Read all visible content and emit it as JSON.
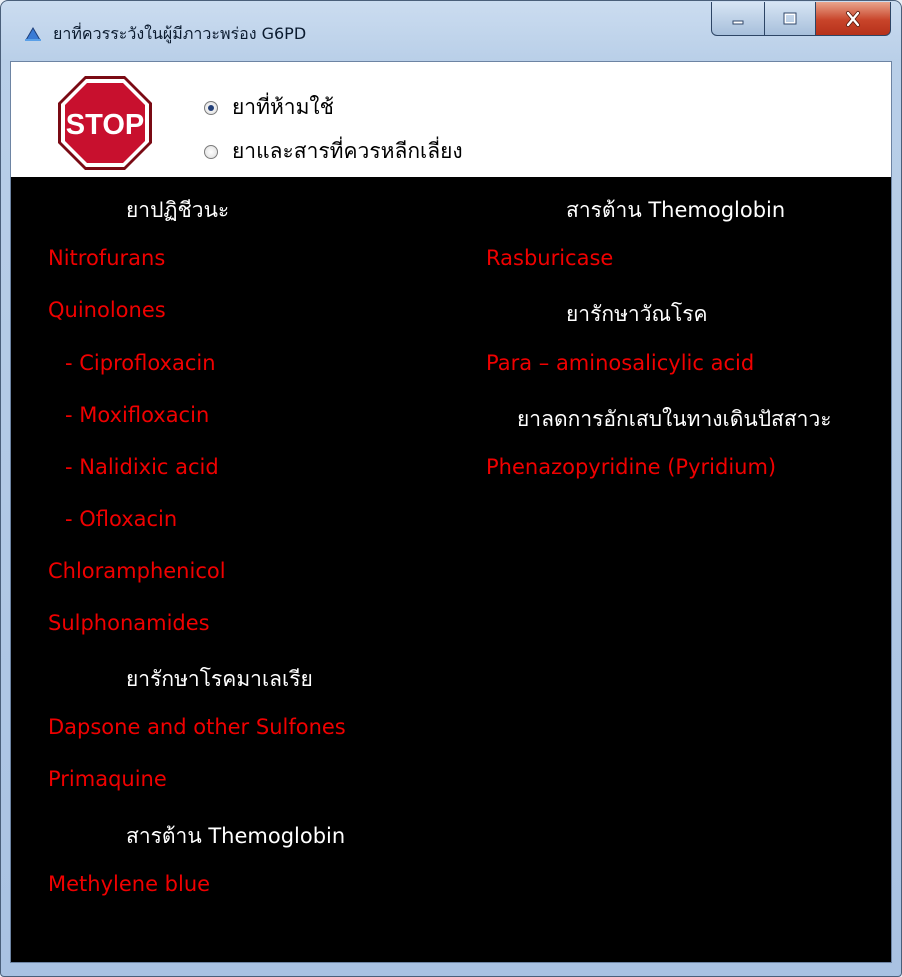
{
  "window": {
    "title": "ยาที่ควรระวังในผู้มีภาวะพร่อง G6PD",
    "caption_buttons": {
      "minimize_icon": "minimize-icon",
      "maximize_icon": "maximize-icon",
      "close_icon": "close-icon"
    }
  },
  "header": {
    "stop_sign_text": "STOP",
    "options": [
      {
        "label": "ยาที่ห้ามใช้",
        "checked": true
      },
      {
        "label": "ยาและสารที่ควรหลีกเลี่ยง",
        "checked": false
      }
    ]
  },
  "left_column": [
    {
      "text": "ยาปฏิชีวนะ",
      "type": "heading"
    },
    {
      "text": "Nitrofurans",
      "type": "drug"
    },
    {
      "text": "Quinolones",
      "type": "drug"
    },
    {
      "text": "- Ciprofloxacin",
      "type": "drug"
    },
    {
      "text": "- Moxifloxacin",
      "type": "drug"
    },
    {
      "text": "- Nalidixic acid",
      "type": "drug"
    },
    {
      "text": "- Ofloxacin",
      "type": "drug"
    },
    {
      "text": "Chloramphenicol",
      "type": "drug"
    },
    {
      "text": "Sulphonamides",
      "type": "drug"
    },
    {
      "text": "ยารักษาโรคมาเลเรีย",
      "type": "heading"
    },
    {
      "text": "Dapsone and other Sulfones",
      "type": "drug"
    },
    {
      "text": "Primaquine",
      "type": "drug"
    },
    {
      "text": "สารต้าน Themoglobin",
      "type": "heading"
    },
    {
      "text": "Methylene blue",
      "type": "drug"
    }
  ],
  "right_column": [
    {
      "text": "สารต้าน Themoglobin",
      "type": "heading"
    },
    {
      "text": "Rasburicase",
      "type": "drug"
    },
    {
      "text": "ยารักษาวัณโรค",
      "type": "heading"
    },
    {
      "text": "Para – aminosalicylic acid",
      "type": "drug"
    },
    {
      "text": "ยาลดการอักเสบในทางเดินปัสสาวะ",
      "type": "heading"
    },
    {
      "text": "Phenazopyridine (Pyridium)",
      "type": "drug"
    }
  ],
  "colors": {
    "drug": "#f00000",
    "heading": "#ffffff",
    "background": "#000000",
    "stop_red": "#c8102e"
  }
}
